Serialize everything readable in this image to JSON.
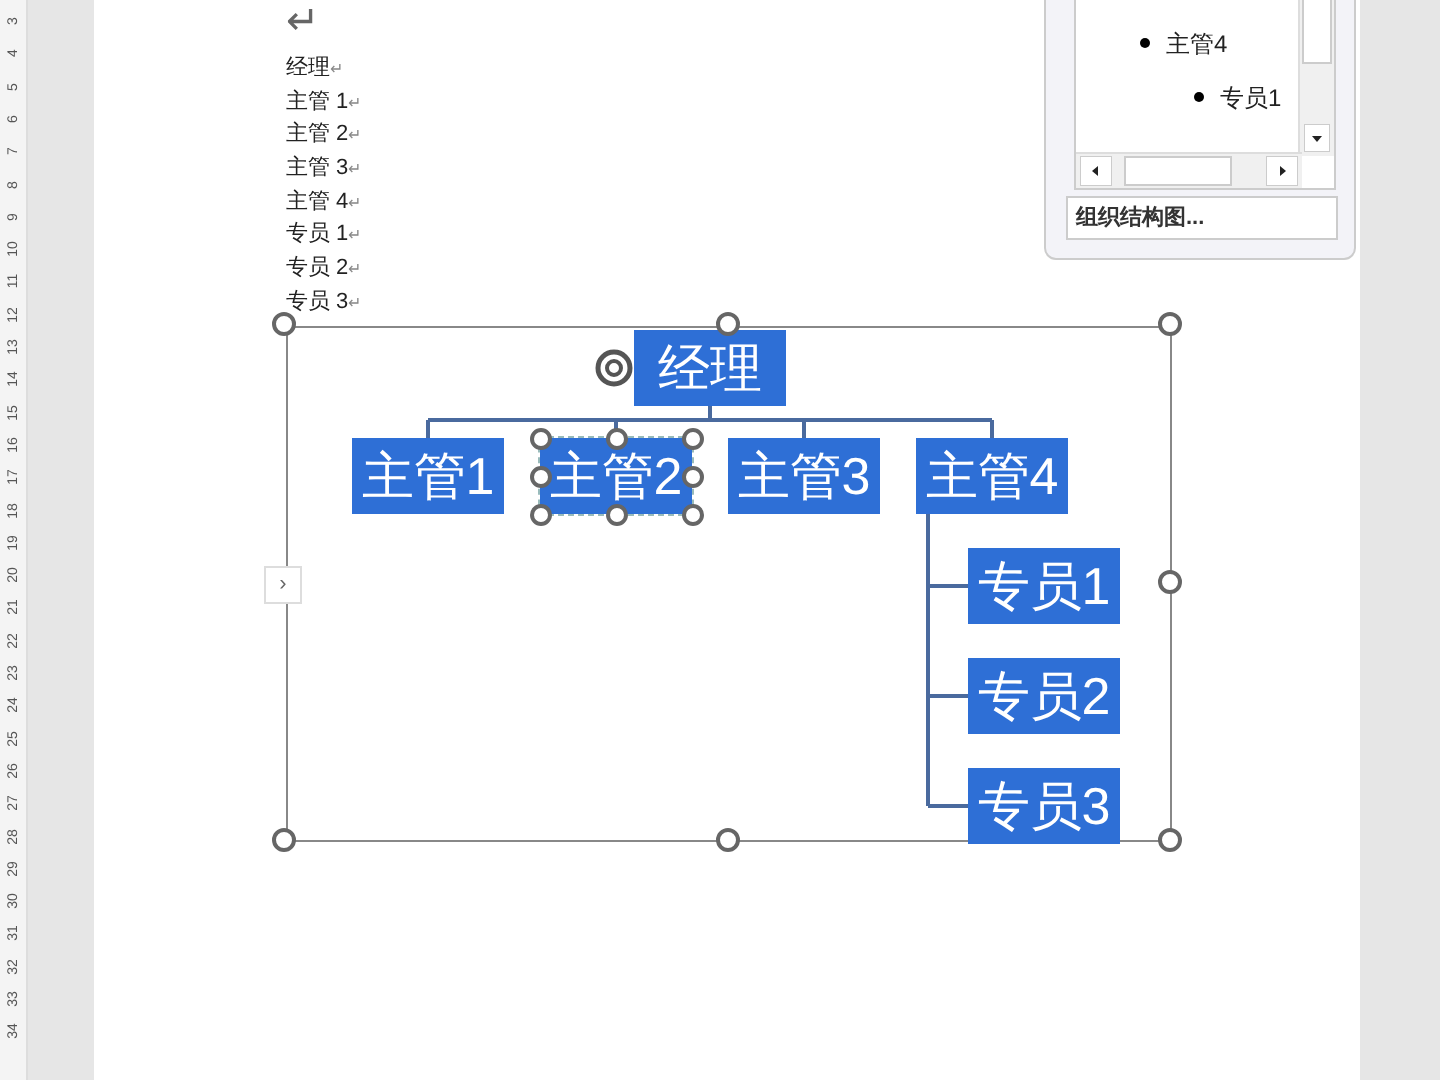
{
  "ruler": {
    "numbers": [
      "3",
      "4",
      "5",
      "6",
      "7",
      "8",
      "9",
      "10",
      "11",
      "12",
      "13",
      "14",
      "15",
      "16",
      "17",
      "18",
      "19",
      "20",
      "21",
      "22",
      "23",
      "24",
      "25",
      "26",
      "27",
      "28",
      "29",
      "30",
      "31",
      "32",
      "33",
      "34"
    ]
  },
  "document": {
    "first_mark": "↵",
    "lines": [
      {
        "text": "经理",
        "mark": "↵"
      },
      {
        "text": "主管 1",
        "mark": "↵"
      },
      {
        "text": "主管 2",
        "mark": "↵"
      },
      {
        "text": "主管 3",
        "mark": "↵"
      },
      {
        "text": "主管 4",
        "mark": "↵"
      },
      {
        "text": "专员 1",
        "mark": "↵"
      },
      {
        "text": "专员 2",
        "mark": "↵"
      },
      {
        "text": "专员 3",
        "mark": "↵"
      }
    ]
  },
  "text_pane": {
    "items": [
      {
        "text": "主管4",
        "children": [
          {
            "text": "专员1"
          }
        ]
      }
    ],
    "footer": "组织结构图...",
    "toggle": "›"
  },
  "org_chart": {
    "root": {
      "text": "经理",
      "selected": false,
      "children": [
        {
          "text": "主管1",
          "selected": false
        },
        {
          "text": "主管2",
          "selected": true
        },
        {
          "text": "主管3",
          "selected": false
        },
        {
          "text": "主管4",
          "selected": false,
          "children": [
            {
              "text": "专员1",
              "selected": false
            },
            {
              "text": "专员2",
              "selected": false
            },
            {
              "text": "专员3",
              "selected": false
            }
          ]
        }
      ]
    }
  }
}
